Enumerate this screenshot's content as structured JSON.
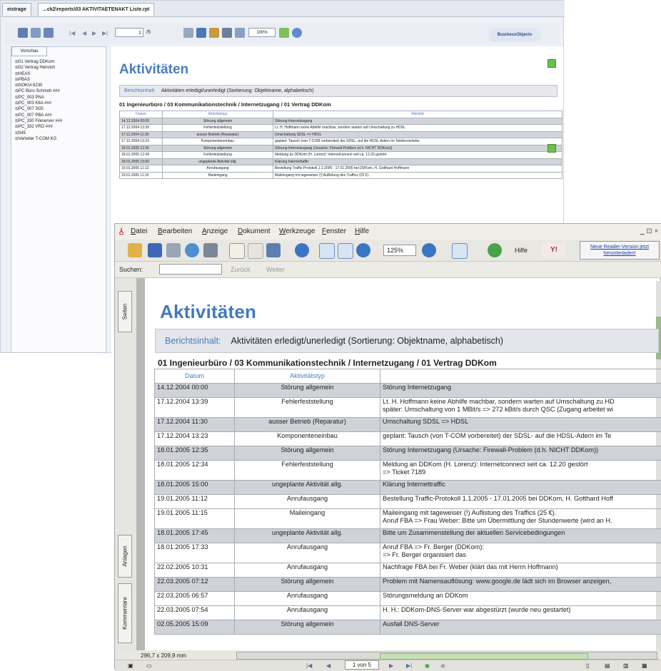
{
  "back_window": {
    "tabs": [
      "eistrage",
      "...ck2\\reports\\03 AKTIVITAETENAKT Liste.rpt"
    ],
    "page_field": "1",
    "page_total": "/5",
    "zoom": "100%",
    "logo_text": "BusinessObjects",
    "side_tab": "Vorschau",
    "tree_items": [
      "01 Vertrag DDKom",
      "02 Vertrag Heinrich",
      "HEAS",
      "PBAS",
      "NOKIA 6230",
      "PC Büro Schmolt ###",
      "PC_003 PNA",
      "PC_003 K6A ###",
      "PC_007 3G5",
      "PC_007 PBA ###",
      "PC_330 Fileserver ###",
      "PC_332 VRD ###",
      "545",
      "Verteiler T-COM KG"
    ],
    "heading": "Aktivitäten",
    "ribbon_label": "Berichtsinhalt:",
    "ribbon_text": "Aktivitäten erledigt/unerledigt (Sortierung: Objektname, alphabetisch)",
    "path": "01 Ingenieurbüro / 03 Kommunikationstechnik / Internetzugang / 01 Vertrag DDKom",
    "columns": [
      "Datum",
      "Aktivitätstyp",
      "Aktivität"
    ],
    "rows": [
      {
        "date": "14.12.2004 00:00",
        "type": "Störung allgemein",
        "text": "Störung Internetzugang",
        "gray": true
      },
      {
        "date": "17.12.2004 13:39",
        "type": "Fehlerfeststellung",
        "text": "Lt. H. Hoffmann keine Abhilfe machbar, sondern warten auf Umschaltung zu HDSL",
        "gray": false
      },
      {
        "date": "17.12.2004 11:30",
        "type": "ausser Betrieb (Reparatur)",
        "text": "Umschaltung SDSL => HDSL",
        "gray": true
      },
      {
        "date": "17.12.2004 13:23",
        "type": "Komponenteneinbau",
        "text": "geplant: Tausch (von T-COM vorbereitet) der SDSL- auf die HDSL-Adern im Telefonverteiler",
        "gray": false
      },
      {
        "date": "18.01.2005 12:35",
        "type": "Störung allgemein",
        "text": "Störung Internetzugang (Ursache: Firewall-Problem (d.h. NICHT DDKom))",
        "gray": true
      },
      {
        "date": "18.01.2005 12:34",
        "type": "Fehlerfeststellung",
        "text": "Meldung an DDKom (H. Lorenz): Internetconnect seit ca. 12.20 gestört",
        "gray": false
      },
      {
        "date": "18.01.2005 15:00",
        "type": "ungeplante Aktivität allg.",
        "text": "Klärung Internettraffic",
        "gray": true
      },
      {
        "date": "19.01.2005 11:12",
        "type": "Anrufausgang",
        "text": "Bestellung Traffic-Protokoll 1.1.2005 - 17.01.2005 bei DDKom, H. Gotthard Hoffmann",
        "gray": false
      },
      {
        "date": "19.01.2005 11:15",
        "type": "Maileingang",
        "text": "Maileingang mit tageweiser (!) Auflistung des Traffics (25 €).",
        "gray": false
      }
    ]
  },
  "front_window": {
    "menu": [
      "Datei",
      "Bearbeiten",
      "Anzeige",
      "Dokument",
      "Werkzeuge",
      "Fenster",
      "Hilfe"
    ],
    "window_controls": "_ ⊡ ×",
    "zoom": "125%",
    "help_label": "Hilfe",
    "update_text": [
      "Neue Reader-Version jetzt",
      "herunterladen!"
    ],
    "search_label": "Suchen:",
    "search_back": "Zurück",
    "search_next": "Weiter",
    "nav_tabs": [
      "Seiten",
      "Anlagen",
      "Kommentare"
    ],
    "heading": "Aktivitäten",
    "ribbon_label": "Berichtsinhalt:",
    "ribbon_text": "Aktivitäten erledigt/unerledigt (Sortierung: Objektname, alphabetisch)",
    "path": "01 Ingenieurbüro / 03 Kommunikationstechnik / Internetzugang / 01 Vertrag DDKom",
    "columns": [
      "Datum",
      "Aktivitätstyp",
      ""
    ],
    "rows": [
      {
        "date": "14.12.2004 00:00",
        "type": "Störung allgemein",
        "text": "Störung Internetzugang",
        "text2": "",
        "gray": true
      },
      {
        "date": "17.12.2004 13:39",
        "type": "Fehlerfeststellung",
        "text": "Lt. H. Hoffmann keine Abhilfe machbar, sondern warten auf Umschaltung zu HD",
        "text2": "später: Umschaltung von 1 MBit/s => 272 kBit/s durch QSC (Zugang arbeitet wi",
        "gray": false
      },
      {
        "date": "17.12.2004 11:30",
        "type": "ausser Betrieb (Reparatur)",
        "text": "Umschaltung SDSL => HDSL",
        "text2": "",
        "gray": true
      },
      {
        "date": "17.12.2004 13:23",
        "type": "Komponenteneinbau",
        "text": "geplant: Tausch (von T-COM vorbereitet) der SDSL- auf die HDSL-Adern im Te",
        "text2": "",
        "gray": false
      },
      {
        "date": "18.01.2005 12:35",
        "type": "Störung allgemein",
        "text": "Störung Internetzugang (Ursache: Firewall-Problem (d.h. NICHT DDKom))",
        "text2": "",
        "gray": true
      },
      {
        "date": "18.01.2005 12:34",
        "type": "Fehlerfeststellung",
        "text": "Meldung an DDKom (H. Lorenz): Internetconnect seit ca. 12.20 gestört",
        "text2": "=> Ticket 7189",
        "gray": false
      },
      {
        "date": "18.01.2005 15:00",
        "type": "ungeplante Aktivität allg.",
        "text": "Klärung Internettraffic",
        "text2": "",
        "gray": true
      },
      {
        "date": "19.01.2005 11:12",
        "type": "Anrufausgang",
        "text": "Bestellung Traffic-Protokoll 1.1.2005 - 17.01.2005 bei DDKom, H. Gotthard Hoff",
        "text2": "",
        "gray": false
      },
      {
        "date": "19.01.2005 11:15",
        "type": "Maileingang",
        "text": "Maileingang mit tageweiser (!) Auflistung des Traffics (25 €).",
        "text2": "Anruf FBA => Frau Weber: Bitte um Übermittlung der Stundenwerte (wird an H.",
        "gray": false
      },
      {
        "date": "18.01.2005 17:45",
        "type": "ungeplante Aktivität allg.",
        "text": "Bitte um Zusammenstellung der aktuellen Servicebedingungen",
        "text2": "",
        "gray": true
      },
      {
        "date": "18.01.2005 17:33",
        "type": "Anrufausgang",
        "text": "Anruf FBA => Fr. Berger (DDKom):",
        "text2": "=> Fr. Berger organisiert das",
        "gray": false
      },
      {
        "date": "22.02.2005 10:31",
        "type": "Anrufausgang",
        "text": "Nachfrage FBA bei Fr. Weber (klärt das mit Herrn Hoffmann)",
        "text2": "",
        "gray": false
      },
      {
        "date": "22.03.2005 07:12",
        "type": "Störung allgemein",
        "text": "Problem mit Namensauflösung: www.google.de lädt sich im Browser anzeigen,",
        "text2": "",
        "gray": true
      },
      {
        "date": "22.03.2005 06:57",
        "type": "Anrufausgang",
        "text": "Störungsmeldung an DDKom",
        "text2": "",
        "gray": false
      },
      {
        "date": "22.03.2005 07:54",
        "type": "Anrufausgang",
        "text": "H. H.: DDKom-DNS-Server war abgestürzt (wurde neu gestartet)",
        "text2": "",
        "gray": false
      },
      {
        "date": "02.05.2005 15:09",
        "type": "Störung allgemein",
        "text": "Ausfall DNS-Server",
        "text2": "",
        "gray": true
      }
    ],
    "page_size": "296,7 x 209,9 mm",
    "page_indicator": "1 von 5"
  }
}
